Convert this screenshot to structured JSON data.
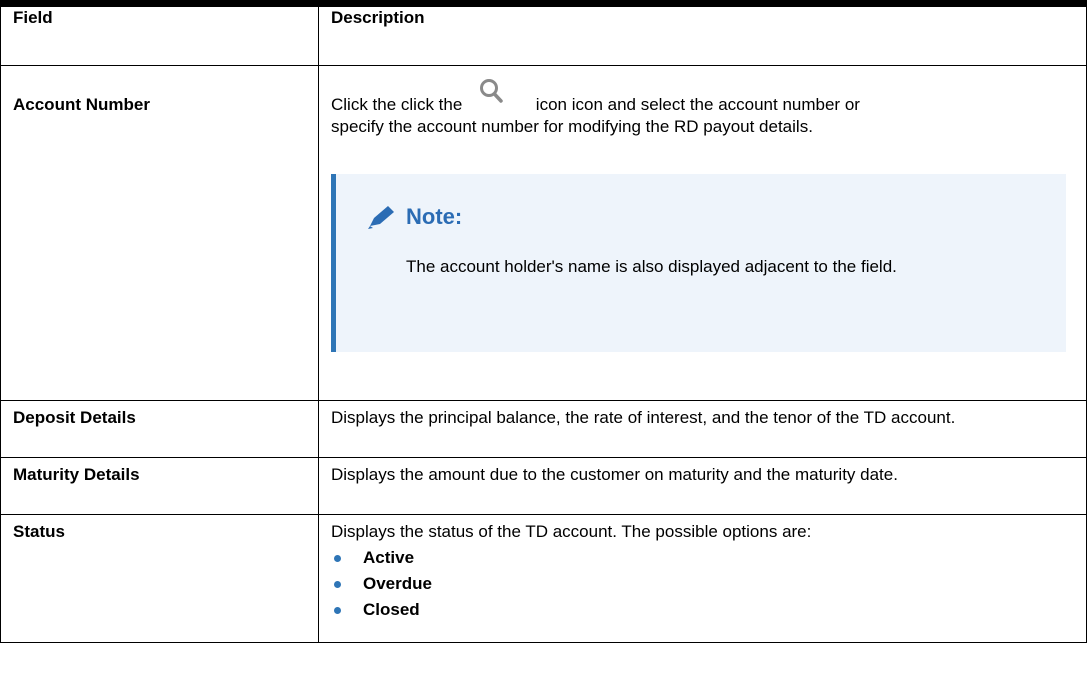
{
  "table": {
    "header": {
      "field": "Field",
      "description": "Description"
    },
    "account_number": {
      "field": "Account Number",
      "text_before_icon": "Click the click the",
      "text_after_icon": "icon icon and select the account number or",
      "text_line2": "specify the account number for modifying the RD payout details.",
      "icon": "search-icon",
      "note": {
        "title": "Note:",
        "body": "The account holder's name is also displayed adjacent to the field."
      }
    },
    "deposit_details": {
      "field": "Deposit Details",
      "description": "Displays the principal balance, the rate of interest, and the tenor of the TD account."
    },
    "maturity_details": {
      "field": "Maturity Details",
      "description": "Displays the amount due to the customer on maturity and the maturity date."
    },
    "status": {
      "field": "Status",
      "description": "Displays the status of the TD account. The possible options are:",
      "options": [
        "Active",
        "Overdue",
        "Closed"
      ]
    }
  },
  "colors": {
    "note_accent": "#2e75b6",
    "note_background": "#eef4fb",
    "bullet": "#2e75b6"
  }
}
